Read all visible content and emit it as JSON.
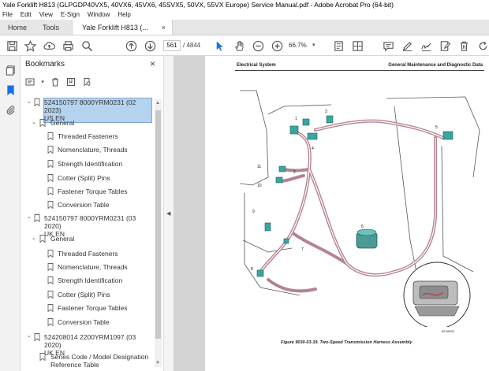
{
  "window": {
    "title": "Yale Forklift H813 (GLPGDP40VX5, 40VX6, 45VX6, 45SVX5, 50VX, 55VX Europe) Service Manual.pdf - Adobe Acrobat Pro (64-bit)"
  },
  "menu": [
    "File",
    "Edit",
    "View",
    "E-Sign",
    "Window",
    "Help"
  ],
  "tabs": {
    "home": "Home",
    "tools": "Tools",
    "doc": "Yale Forklift H813 (...",
    "close": "×"
  },
  "toolbar": {
    "page_current": "561",
    "page_total": "/ 4844",
    "zoom": "66.7%"
  },
  "bookmarks": {
    "title": "Bookmarks",
    "close": "×",
    "items": [
      {
        "label": "524150797 8000YRM0231 (02 2023) US EN",
        "line1": "524150797 8000YRM0231 (02 2023)",
        "line2": "US EN"
      },
      {
        "label": "General"
      },
      {
        "label": "Threaded Fasteners"
      },
      {
        "label": "Nomenclature, Threads"
      },
      {
        "label": "Strength Identification"
      },
      {
        "label": "Cotter (Split) Pins"
      },
      {
        "label": "Fastener Torque Tables"
      },
      {
        "label": "Conversion Table"
      },
      {
        "label": "524150797 8000YRM0231 (03 2020) UK EN",
        "line1": "524150797 8000YRM0231 (03 2020)",
        "line2": "UK EN"
      },
      {
        "label": "General"
      },
      {
        "label": "Threaded Fasteners"
      },
      {
        "label": "Nomenclature, Threads"
      },
      {
        "label": "Strength Identification"
      },
      {
        "label": "Cotter (Split) Pins"
      },
      {
        "label": "Fastener Torque Tables"
      },
      {
        "label": "Conversion Table"
      },
      {
        "label": "524208014 2200YRM1097 (03 2020) UK EN",
        "line1": "524208014 2200YRM1097 (03 2020)",
        "line2": "UK EN"
      },
      {
        "label": "Series Code / Model Designation Reference Table",
        "line1": "Series Code / Model Designation",
        "line2": "Reference Table"
      }
    ]
  },
  "document": {
    "header_left": "Electrical System",
    "header_right": "General Maintenance and Diagnostic Data",
    "figure_caption": "Figure 9030-03-19. Two-Speed Transmission Harness Assembly",
    "figure_id": "BT98032",
    "callouts": [
      "1",
      "2",
      "3",
      "4",
      "5",
      "6",
      "7",
      "8",
      "9",
      "10",
      "11"
    ]
  }
}
